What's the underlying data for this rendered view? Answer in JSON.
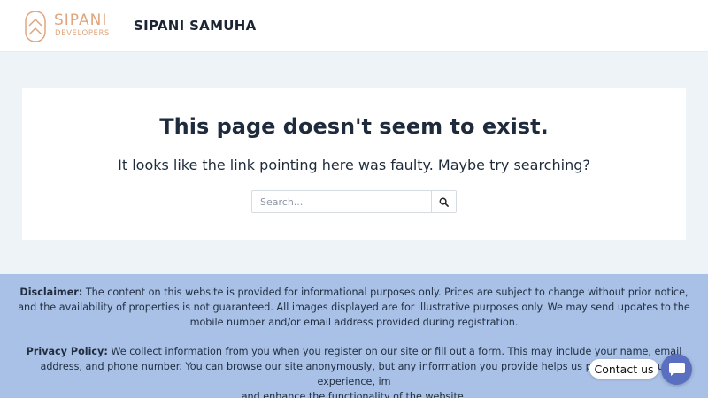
{
  "header": {
    "logo_word": "SIPANI",
    "logo_sub": "DEVELOPERS",
    "site_title": "SIPANI SAMUHA"
  },
  "main": {
    "title": "This page doesn't seem to exist.",
    "subtitle": "It looks like the link pointing here was faulty. Maybe try searching?",
    "search": {
      "placeholder": "Search...",
      "value": ""
    }
  },
  "footer": {
    "disclaimer_label": "Disclaimer:",
    "disclaimer_text": " The content on this website is provided for informational purposes only. Prices are subject to change without prior notice, and the availability of properties is not guaranteed. All images displayed are for illustrative purposes only.  We may send updates to the mobile number and/or email address provided during registration.",
    "privacy_label": "Privacy Policy:",
    "privacy_text": " We collect information from you when you register on our site or fill out a form. This may include your name, email address, and phone number. You can browse our site anonymously, but any information you provide helps us personalize your experience, im",
    "privacy_tail": "and enhance the functionality of the website."
  },
  "contact": {
    "label": "Contact us"
  },
  "colors": {
    "brand_logo": "#e0a57e",
    "footer_bg": "#a9c1e7",
    "contact_btn": "#5a6fbf",
    "page_bg": "#eef3f8"
  },
  "icons": {
    "logo": "sipani-logo-icon",
    "search": "search-icon",
    "chat": "chat-icon"
  }
}
